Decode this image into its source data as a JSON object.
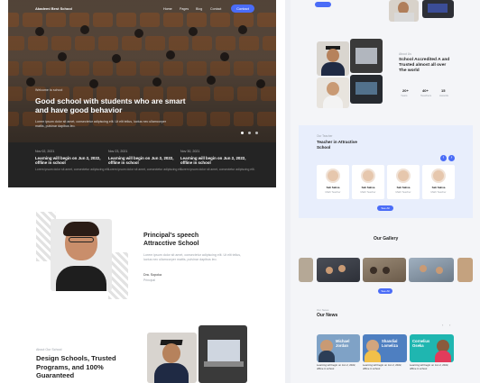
{
  "nav": {
    "logo": "Akademi Best School",
    "links": [
      "Home",
      "Pages",
      "Blog",
      "Contact"
    ],
    "cta": "Contact"
  },
  "hero": {
    "eyebrow": "Welcome to school",
    "title": "Good school with students who are smart and have good behavior",
    "text": "Lorem ipsum dolor sit amet, consectetur adipiscing elit. Ut elit tellus, luctus nec ullamcorper mattis, pulvinar dapibus leo."
  },
  "news_strip": [
    {
      "date": "Nov 02, 2021",
      "title": "Learning will begin on Jun 2, 2022, offline in school",
      "text": "Lorem ipsum dolor sit amet, consectetur adipiscing elit."
    },
    {
      "date": "Nov 23, 2021",
      "title": "Learning will begin on Jun 2, 2022, offline in school",
      "text": "Lorem ipsum dolor sit amet, consectetur adipiscing elit."
    },
    {
      "date": "Nov 30, 2021",
      "title": "Learning will begin on Jun 2, 2022, offline in school",
      "text": "Lorem ipsum dolor sit amet, consectetur adipiscing elit."
    }
  ],
  "principal": {
    "title": "Principal's speech Attracctive School",
    "text": "Lorem ipsum dolor sit amet, consectetur adipiscing elit. Ut elit tellus, luctus nec ullamcorper mattis, pulvinar dapibus leo.",
    "name": "Dra. Sopoka",
    "role": "Principal"
  },
  "about": {
    "eyebrow": "About Our School",
    "title": "Design Schools, Trusted Programs, and 100% Guaranteed"
  },
  "accredited": {
    "eyebrow": "About Us",
    "title": "School Accredited A and Trusted almost all over The world",
    "stats": [
      {
        "value": "20+",
        "label": "Years"
      },
      {
        "value": "40+",
        "label": "Teachers"
      },
      {
        "value": "15",
        "label": "Awards"
      }
    ]
  },
  "teachers": {
    "eyebrow": "Our Teacher",
    "title": "Teacher in Attractive School",
    "cards": [
      {
        "name": "Sali Saliva",
        "subject": "Math Teacher"
      },
      {
        "name": "Sali Saliva",
        "subject": "Math Teacher"
      },
      {
        "name": "Sali Saliva",
        "subject": "Math Teacher"
      },
      {
        "name": "Sali Saliva",
        "subject": "Math Teacher"
      }
    ],
    "button": "See All"
  },
  "gallery": {
    "title": "Our Gallery",
    "button": "See All"
  },
  "news": {
    "eyebrow": "Our News",
    "title": "Our News",
    "cards": [
      {
        "person": "Michael Jordan",
        "caption": "Learning will begin on Jun 2, 2022, offline in school"
      },
      {
        "person": "Shandial Lomeliza",
        "caption": "Learning will begin on Jun 2, 2022, offline in school"
      },
      {
        "person": "Cornelius Oseka",
        "caption": "Learning will begin on Jun 2, 2022, offline in school"
      }
    ]
  },
  "colors": {
    "accent": "#4a6cf7",
    "dark": "#242424",
    "teacher_bg": "#e8eefc"
  }
}
